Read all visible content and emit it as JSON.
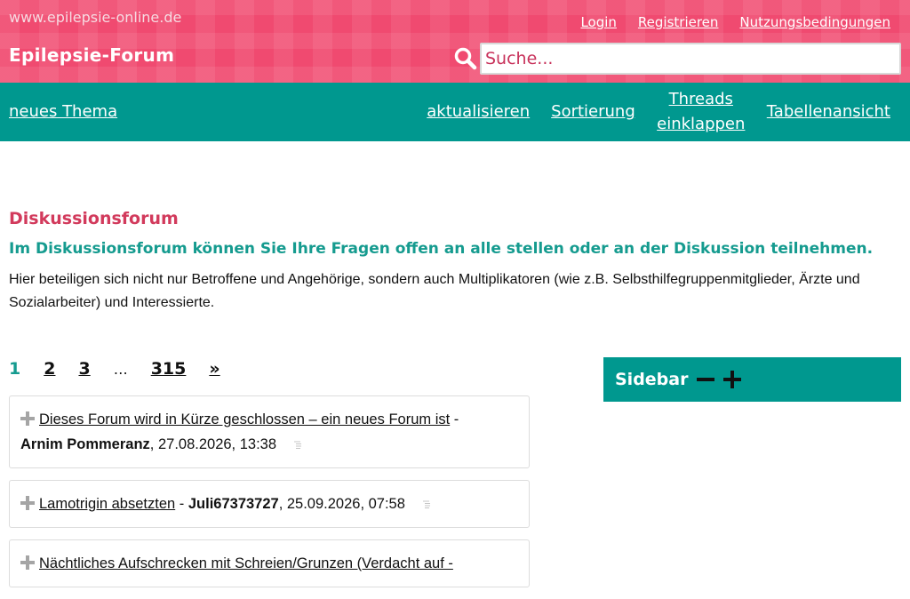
{
  "header": {
    "site_url": "www.epilepsie-online.de",
    "forum_title": "Epilepsie-Forum",
    "links": {
      "login": "Login",
      "register": "Registrieren",
      "terms": "Nutzungsbedingungen"
    },
    "search": {
      "placeholder": "Suche...",
      "icon": "search-icon"
    }
  },
  "navbar": {
    "new_topic": "neues Thema",
    "refresh": "aktualisieren",
    "sorting": "Sortierung",
    "collapse_threads_line1": "Threads",
    "collapse_threads_line2": "einklappen",
    "table_view": "Tabellenansicht"
  },
  "main": {
    "title": "Diskussionsforum",
    "subtitle": "Im Diskussionsforum können Sie Ihre Fragen offen an alle stellen oder an der Diskussion teilnehmen.",
    "intro": "Hier beteiligen sich nicht nur Betroffene und Angehörige, sondern auch Multiplikatoren (wie z.B. Selbsthilfegruppenmitglieder, Ärzte und Sozialarbeiter) und Interessierte."
  },
  "pagination": {
    "current": "1",
    "p2": "2",
    "p3": "3",
    "ellipsis": "…",
    "last": "315",
    "next": "»"
  },
  "threads": [
    {
      "title": "Dieses Forum wird in Kürze geschlossen – ein neues Forum ist",
      "sep": " - ",
      "author": "Arnim Pommeranz",
      "date": ", 27.08.2026, 13:38"
    },
    {
      "title": "Lamotrigin absetzten",
      "sep": " - ",
      "author": "Juli67373727",
      "date": ", 25.09.2026, 07:58"
    },
    {
      "title": "Nächtliches Aufschrecken mit Schreien/Grunzen (Verdacht auf -",
      "sep": "",
      "author": "",
      "date": ""
    }
  ],
  "sidebar": {
    "label": "Sidebar"
  },
  "colors": {
    "header_bg": "#e8325b",
    "nav_bg": "#00988f",
    "accent_red": "#d23a5c",
    "accent_teal": "#159b8f"
  }
}
